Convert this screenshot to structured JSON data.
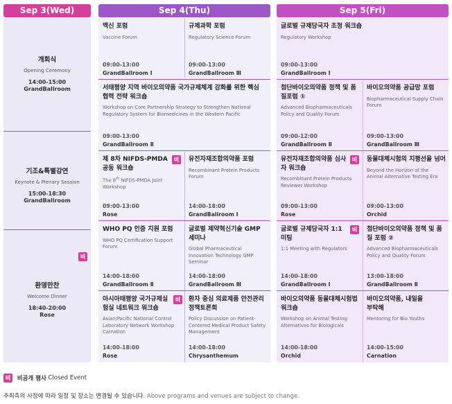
{
  "headers": {
    "d1": "Sep 3(Wed)",
    "d2": "Sep 4(Thu)",
    "d3": "Sep 5(Fri)"
  },
  "colors": {
    "day1_header": "#d63e9c",
    "day2_header": "#9c56c6",
    "day3_header": "#c350c3",
    "badge": "#d63e9c"
  },
  "badge_text": "비",
  "day1": [
    {
      "ko": "개회식",
      "en": "Opening Ceremony",
      "time": "14:00-15:00",
      "venue": "GrandBallroom"
    },
    {
      "ko": "기조&특별강연",
      "en": "Keynote & Plenary Session",
      "time": "15:00-18:30",
      "venue": "GrandBallroom"
    },
    {
      "ko": "환영만찬",
      "en": "Welcome Dinner",
      "time": "18:40-20:00",
      "venue": "Rose"
    }
  ],
  "day2": [
    {
      "ko": "백신 포럼",
      "en": "Vaccine Forum",
      "time": "09:00-13:00",
      "venue": "GrandBallroom Ⅰ"
    },
    {
      "ko": "규제과학 포럼",
      "en": "Regulatory Science Forum",
      "time": "09:00-13:00",
      "venue": "GrandBallroom Ⅲ"
    },
    {
      "ko": "서태평양 지역 바이오의약품 국가규제체계 강화를 위한 핵심 협력 전략 워크숍",
      "en": "Workshop on Core Partnership Strategy to Strengthen National Regulatory System for Biomedicines in the Western Pacific",
      "time": "09:00-13:00",
      "venue": "GrandBallroom Ⅱ"
    },
    {
      "ko": "제 8차 NIFDS-PMDA 공동 워크숍",
      "en_pre": "The 8",
      "en_sup": "th",
      "en_post": " NIFDS-PMDA Joint Workshop",
      "time": "09:00-13:00",
      "venue": "Rose"
    },
    {
      "ko": "유전자재조합의약품 포럼",
      "en": "Recombinant Protein Products Forum",
      "time": "14:00-18:00",
      "venue": "GrandBallroom Ⅰ"
    },
    {
      "ko": "WHO PQ 인증 지원 포럼",
      "en": "WHO PQ Certification Support Forum",
      "time": "14:00-18:00",
      "venue": "GrandBallroom Ⅱ"
    },
    {
      "ko": "글로벌 제약혁신기술 GMP 세미나",
      "en": "Global Pharmaceutical Innovation Technology GMP Seminar",
      "time": "14:00-18:00",
      "venue": "GrandBallroom Ⅲ"
    },
    {
      "ko": "아시아태평양 국가규제실험실 네트워크 워크숍",
      "en": "Asian/Pacific National Control Laboratory Network Workshop Carnation",
      "time": "14:00-18:00",
      "venue": "Rose"
    },
    {
      "ko": "환자 중심 의료제품 안전관리 정책토론회",
      "en": "Policy Discussion on Patient-Centered Medical Product Safety Management",
      "time": "14:00-18:00",
      "venue": "Chrysanthemum"
    }
  ],
  "day3": [
    {
      "ko": "글로벌 규제당국자 초청 워크숍",
      "en": "Regulatory Workshop",
      "time": "09:00-13:00",
      "venue": "GrandBallroom Ⅰ"
    },
    {
      "ko": "첨단바이오의약품 정책 및 품질포럼 ①",
      "en": "Advanced Biopharmaceuticals Policy and Quality Forum",
      "time": "09:00-12:00",
      "venue": "GrandBallroom Ⅱ"
    },
    {
      "ko": "바이오의약품 공급망 포럼",
      "en": "Biopharmaceutical Supply Chain Forum",
      "time": "09:00-13:00",
      "venue": "GrandBallroom Ⅲ"
    },
    {
      "ko": "유전자재조합의약품 심사자 워크숍",
      "en": "Recombinant Protein Products Reviewer Workshop",
      "time": "09:00-13:00",
      "venue": "Rose"
    },
    {
      "ko": "동물대체시험의 지평선을 넘어",
      "en": "Beyond the Horizon of the Animal Alternative Testing Era",
      "time": "09:00-13:00",
      "venue": "Orchid"
    },
    {
      "ko": "글로벌 규제당국자 1:1 미팅",
      "en": "1:1 Meeting with Regulators",
      "time": "14:00-18:00",
      "venue": "GrandBallroom Ⅰ"
    },
    {
      "ko": "첨단바이오의약품 정책 및 품질 포럼 ②",
      "en": "Advanced Biopharmaceuticals Policy and Quality Forum",
      "time": "13:00-18:00",
      "venue": "GrandBallroom Ⅱ"
    },
    {
      "ko": "바이오의약품 동물대체시험법 워크숍",
      "en": "Workshop on Animal Testing Alternatives for Biologicals",
      "time": "14:00-18:00",
      "venue": "Orchid"
    },
    {
      "ko": "바이오의약품, 내일을 부탁해",
      "en": "Mentoring for Bio Youths",
      "time": "14:00-15:00",
      "venue": "Carnation"
    }
  ],
  "legend": {
    "ko": "비공개 행사",
    "en": "Closed Event"
  },
  "note": {
    "ko": "주최측의 사정에 따라 일정 및 장소는 변경될 수 있습니다.",
    "en": "Above programs and venues are subject to change."
  }
}
